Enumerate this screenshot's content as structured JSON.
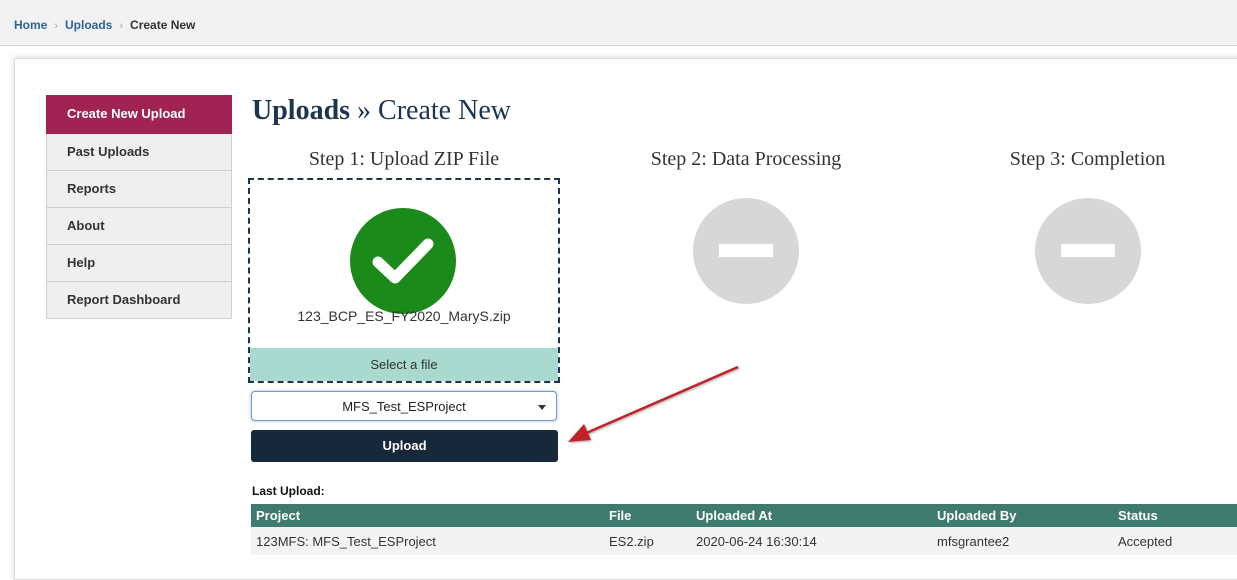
{
  "breadcrumb": {
    "home": "Home",
    "uploads": "Uploads",
    "current": "Create New"
  },
  "sidebar": {
    "items": [
      {
        "label": "Create New Upload"
      },
      {
        "label": "Past Uploads"
      },
      {
        "label": "Reports"
      },
      {
        "label": "About"
      },
      {
        "label": "Help"
      },
      {
        "label": "Report Dashboard"
      }
    ]
  },
  "page": {
    "title_bold": "Uploads",
    "title_rest": " » Create New"
  },
  "steps": [
    {
      "title": "Step 1: Upload ZIP File",
      "status": "complete"
    },
    {
      "title": "Step 2: Data Processing",
      "status": "pending"
    },
    {
      "title": "Step 3: Completion",
      "status": "pending"
    }
  ],
  "upload": {
    "file_name": "123_BCP_ES_FY2020_MaryS.zip",
    "select_file_label": "Select a file",
    "project_value": "MFS_Test_ESProject",
    "upload_button": "Upload"
  },
  "last_upload": {
    "label": "Last Upload:",
    "columns": [
      "Project",
      "File",
      "Uploaded At",
      "Uploaded By",
      "Status"
    ],
    "rows": [
      [
        "123MFS: MFS_Test_ESProject",
        "ES2.zip",
        "2020-06-24 16:30:14",
        "mfsgrantee2",
        "Accepted"
      ]
    ]
  },
  "colors": {
    "active_nav": "#a02353",
    "success": "#1b8a1b",
    "pending": "#d7d7d7",
    "table_header": "#3f7a6e",
    "button": "#16283a",
    "arrow": "#c0232b"
  }
}
